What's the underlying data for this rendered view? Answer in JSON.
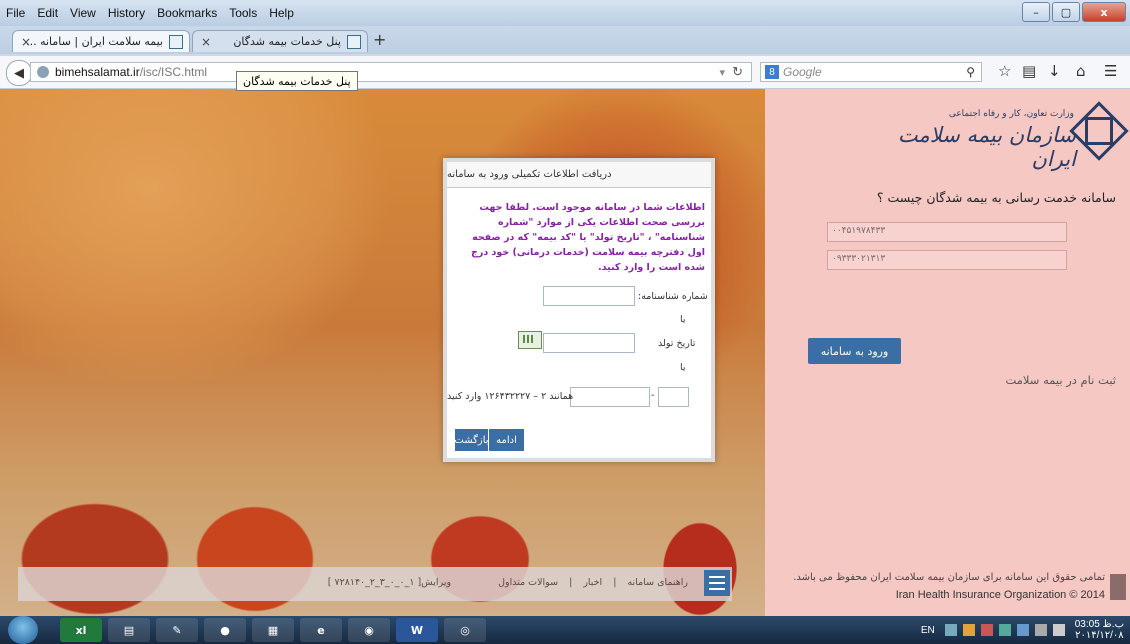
{
  "browser": {
    "menu": [
      "File",
      "Edit",
      "View",
      "History",
      "Bookmarks",
      "Tools",
      "Help"
    ],
    "window_buttons": [
      "–",
      "▢",
      "x"
    ],
    "tabs": [
      {
        "label": "بیمه سلامت ایران | سامانه ...",
        "close": "×"
      },
      {
        "label": "پنل خدمات بیمه شدگان",
        "close": "×"
      }
    ],
    "new_tab": "+",
    "url_host": "bimehsalamat.ir",
    "url_path": "/isc/ISC.html",
    "tooltip": "پنل خدمات بیمه شدگان",
    "search_engine": "8",
    "search_placeholder": "Google",
    "icons": [
      "back-icon",
      "reload-icon",
      "search-icon",
      "star-icon",
      "bookmarks-icon",
      "download-icon",
      "home-icon",
      "menu-icon"
    ]
  },
  "right_panel": {
    "logo_small": "وزارت تعاون، کار و رفاه اجتماعی",
    "logo_main": "سازمان بیمه سلامت ایران",
    "question": "سامانه خدمت رسانی به بیمه شدگان چیست ؟",
    "input1_value": "۰۰۴۵۱۹۷۸۴۳۳",
    "input2_value": "۰۹۳۳۳۰۲۱۳۱۳",
    "login_button": "ورود به سامانه",
    "register_link": "ثبت نام در بیمه سلامت",
    "copyright_fa": "تمامی حقوق این سامانه برای سازمان بیمه سلامت ایران محفوظ می باشد.",
    "copyright_en": "Iran Health Insurance Organization © 2014"
  },
  "bottom_bar": {
    "links": [
      "راهنمای سامانه",
      "|",
      "اخبار",
      "|",
      "سوالات متداول"
    ],
    "version": "ویرایش[ ۱_۰_۰_۳_۲_۷۲۸۱۴۰ ]"
  },
  "modal": {
    "title": "دریافت اطلاعات تکمیلی ورود به سامانه",
    "message": "اطلاعات شما در سامانه موجود است. لطفا جهت بررسی صحت اطلاعات یکی از موارد \"شماره شناسنامه\" ، \"تاریخ تولد\" یا \"کد بیمه\" که در صفحه اول دفترچه بیمه سلامت (خدمات درمانی) خود درج شده است را وارد کنید.",
    "id_label": "شماره شناسنامه:",
    "or1": "یا",
    "birth_label": "تاریخ تولد",
    "or2": "یا",
    "code_hint": "همانند ۲ – ۱۲۶۴۳۲۲۲۷ وارد کنید",
    "dash": "-",
    "continue_button": "ادامه",
    "back_button": "بازگشت"
  },
  "taskbar": {
    "apps": [
      "xl",
      "▤",
      "✎",
      "●",
      "▦",
      "e",
      "◉",
      "W",
      "◎"
    ],
    "lang": "EN",
    "time": "03:05 ب.ظ",
    "date": "۲۰۱۴/۱۲/۰۸"
  }
}
